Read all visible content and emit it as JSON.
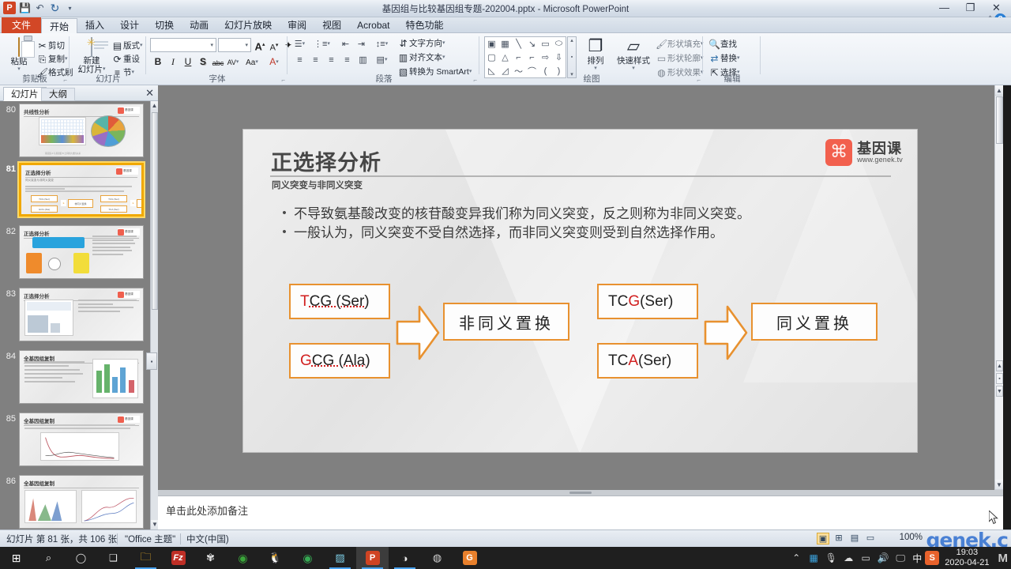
{
  "window": {
    "title": "基因组与比较基因组专题-202004.pptx  -  Microsoft PowerPoint",
    "app_icon": "P",
    "minimize": "—",
    "restore": "❐",
    "close": "✕",
    "help": "?",
    "ribbon_minimize": "^",
    "quick_access": [
      {
        "name": "save-icon",
        "glyph": "💾"
      },
      {
        "name": "undo-icon",
        "glyph": "↶"
      },
      {
        "name": "redo-icon",
        "glyph": "↻"
      },
      {
        "name": "customize-qat-icon",
        "glyph": "▾"
      }
    ]
  },
  "tabs": [
    {
      "label": "文件",
      "id": "file",
      "active": false
    },
    {
      "label": "开始",
      "id": "home",
      "active": true
    },
    {
      "label": "插入",
      "id": "insert",
      "active": false
    },
    {
      "label": "设计",
      "id": "design",
      "active": false
    },
    {
      "label": "切换",
      "id": "transitions",
      "active": false
    },
    {
      "label": "动画",
      "id": "animations",
      "active": false
    },
    {
      "label": "幻灯片放映",
      "id": "slideshow",
      "active": false
    },
    {
      "label": "审阅",
      "id": "review",
      "active": false
    },
    {
      "label": "视图",
      "id": "view",
      "active": false
    },
    {
      "label": "Acrobat",
      "id": "acrobat",
      "active": false
    },
    {
      "label": "特色功能",
      "id": "features",
      "active": false
    }
  ],
  "ribbon": {
    "groups": {
      "clipboard": {
        "label": "剪贴板",
        "paste": "粘贴",
        "items": [
          {
            "label": "剪切",
            "icon": "scissors-icon",
            "glyph": "✂"
          },
          {
            "label": "复制",
            "icon": "copy-icon",
            "glyph": "⎘"
          },
          {
            "label": "格式刷",
            "icon": "format-painter-icon",
            "glyph": "🖌"
          }
        ]
      },
      "slides": {
        "label": "幻灯片",
        "new_slide_line1": "新建",
        "new_slide_line2": "幻灯片",
        "items": [
          {
            "label": "版式",
            "icon": "layout-icon",
            "glyph": "▤"
          },
          {
            "label": "重设",
            "icon": "reset-icon",
            "glyph": "⟳"
          },
          {
            "label": "节",
            "icon": "section-icon",
            "glyph": "≡"
          }
        ]
      },
      "font": {
        "label": "字体",
        "font_name_value": "",
        "font_size_value": "",
        "grow": "A",
        "shrink": "A",
        "clear_format": "✦",
        "buttons": [
          {
            "label": "B",
            "name": "bold-button"
          },
          {
            "label": "I",
            "name": "italic-button"
          },
          {
            "label": "U",
            "name": "underline-button"
          },
          {
            "label": "S",
            "name": "shadow-button"
          },
          {
            "label": "abc",
            "name": "strikethrough-button"
          },
          {
            "label": "AV",
            "name": "character-spacing-button"
          },
          {
            "label": "Aa",
            "name": "change-case-button"
          },
          {
            "label": "A",
            "name": "font-color-button"
          }
        ]
      },
      "paragraph": {
        "label": "段落",
        "text_direction": "文字方向",
        "align_text": "对齐文本",
        "convert_smartart": "转换为 SmartArt"
      },
      "drawing": {
        "label": "绘图",
        "arrange": "排列",
        "quick_styles": "快速样式",
        "shape_fill": "形状填充",
        "shape_outline": "形状轮廓",
        "shape_effects": "形状效果",
        "shapes": [
          "▣",
          "▦",
          "╲",
          "╲",
          "▭",
          "⬭",
          "▢",
          "△",
          "⌐",
          "⌐",
          "⇨",
          "⇩",
          "◺",
          "◿",
          "〜",
          "〰",
          "(",
          ")"
        ]
      },
      "editing": {
        "label": "编辑",
        "find": "查找",
        "replace": "替换",
        "select": "选择"
      }
    }
  },
  "panel": {
    "tab_slides": "幻灯片",
    "tab_outline": "大纲",
    "close": "✕",
    "thumbnails": [
      {
        "number": "80",
        "title": "共线性分析",
        "type": "charts",
        "selected": false
      },
      {
        "number": "81",
        "title": "正选择分析",
        "subtitle": "同义突变与非同义突变",
        "type": "current",
        "selected": true
      },
      {
        "number": "82",
        "title": "正选择分析",
        "type": "codon-wheel",
        "selected": false
      },
      {
        "number": "83",
        "title": "正选择分析",
        "type": "table-chart",
        "selected": false
      },
      {
        "number": "84",
        "title": "全基因组复制",
        "type": "bar-chart",
        "selected": false
      },
      {
        "number": "85",
        "title": "全基因组复制",
        "type": "line-chart",
        "selected": false
      },
      {
        "number": "86",
        "title": "全基因组复制",
        "type": "density-chart",
        "selected": false
      }
    ]
  },
  "slide": {
    "title": "正选择分析",
    "subtitle": "同义突变与非同义突变",
    "logo": {
      "name": "基因课",
      "url": "www.genek.tv",
      "mark": "DNA"
    },
    "bullets": [
      "不导致氨基酸改变的核苷酸变异我们称为同义突变，反之则称为非同义突变。",
      "一般认为，同义突变不受自然选择，而非同义突变则受到自然选择作用。"
    ],
    "diagram": {
      "groups": [
        {
          "name": "nonsynonymous",
          "codon_top": {
            "prefix": "T",
            "rest": "CG (Ser)",
            "highlight": "T"
          },
          "codon_bottom": {
            "prefix": "G",
            "rest": "CG (Ala)",
            "highlight": "G"
          },
          "result": "非同义置换"
        },
        {
          "name": "synonymous",
          "codon_top": {
            "prefix": "TC",
            "rest": "G (Ser)",
            "highlight": "G"
          },
          "codon_bottom": {
            "prefix": "TC",
            "rest": "A (Ser)",
            "highlight": "A"
          },
          "result": "同义置换"
        }
      ]
    }
  },
  "notes": {
    "placeholder": "单击此处添加备注"
  },
  "status": {
    "slide_counter": "幻灯片 第 81 张，共 106 张",
    "theme": "\"Office 主题\"",
    "language": "中文(中国)",
    "zoom": "100%",
    "views": [
      {
        "name": "normal-view-button",
        "glyph": "▣",
        "selected": true
      },
      {
        "name": "slide-sorter-button",
        "glyph": "⊞",
        "selected": false
      },
      {
        "name": "reading-view-button",
        "glyph": "▤",
        "selected": false
      },
      {
        "name": "slideshow-button",
        "glyph": "▭",
        "selected": false
      }
    ],
    "watermark": "genek.c"
  },
  "taskbar": {
    "items": [
      {
        "name": "start-button",
        "glyph": "⊞",
        "color": "#ffffff",
        "bg": ""
      },
      {
        "name": "search-icon",
        "glyph": "○",
        "color": "#e8e8e8",
        "bg": ""
      },
      {
        "name": "cortana-icon",
        "glyph": "◯",
        "color": "#e8e8e8",
        "bg": ""
      },
      {
        "name": "task-view-icon",
        "glyph": "❑",
        "color": "#e8e8e8",
        "bg": ""
      },
      {
        "name": "file-explorer-icon",
        "glyph": "🗀",
        "color": "#f0b429",
        "bg": ""
      },
      {
        "name": "filezilla-icon",
        "glyph": "Fz",
        "color": "#ffffff",
        "bg": "#bf2f26"
      },
      {
        "name": "design-app-icon",
        "glyph": "✾",
        "color": "#dedede",
        "bg": ""
      },
      {
        "name": "evernote-icon",
        "glyph": "◉",
        "color": "#3aa53a",
        "bg": ""
      },
      {
        "name": "qq-icon",
        "glyph": "🐧",
        "color": "#e8e8e8",
        "bg": ""
      },
      {
        "name": "chrome-icon",
        "glyph": "◉",
        "color": "#36a853",
        "bg": ""
      },
      {
        "name": "snipping-tool-icon",
        "glyph": "▨",
        "color": "#7fd0e8",
        "bg": ""
      },
      {
        "name": "powerpoint-icon",
        "glyph": "P",
        "color": "#ffffff",
        "bg": "#d04423"
      },
      {
        "name": "media-player-icon",
        "glyph": "◑",
        "color": "#e8e8e8",
        "bg": ""
      },
      {
        "name": "obs-icon",
        "glyph": "◍",
        "color": "#d8d8d8",
        "bg": ""
      },
      {
        "name": "gold-app-icon",
        "glyph": "G",
        "color": "#ffffff",
        "bg": "#e8802c"
      }
    ],
    "tray": [
      {
        "name": "show-hidden-icons",
        "glyph": "⌃"
      },
      {
        "name": "network-tool-icon",
        "glyph": "▦"
      },
      {
        "name": "microphone-icon",
        "glyph": "🎙"
      },
      {
        "name": "cloud-icon",
        "glyph": "☁"
      },
      {
        "name": "battery-icon",
        "glyph": "▭"
      },
      {
        "name": "volume-icon",
        "glyph": "🔊"
      },
      {
        "name": "display-icon",
        "glyph": "🖵"
      }
    ],
    "ime": "中",
    "sogou": "S",
    "time": "19:03",
    "date": "2020-04-21",
    "corner": "M"
  }
}
